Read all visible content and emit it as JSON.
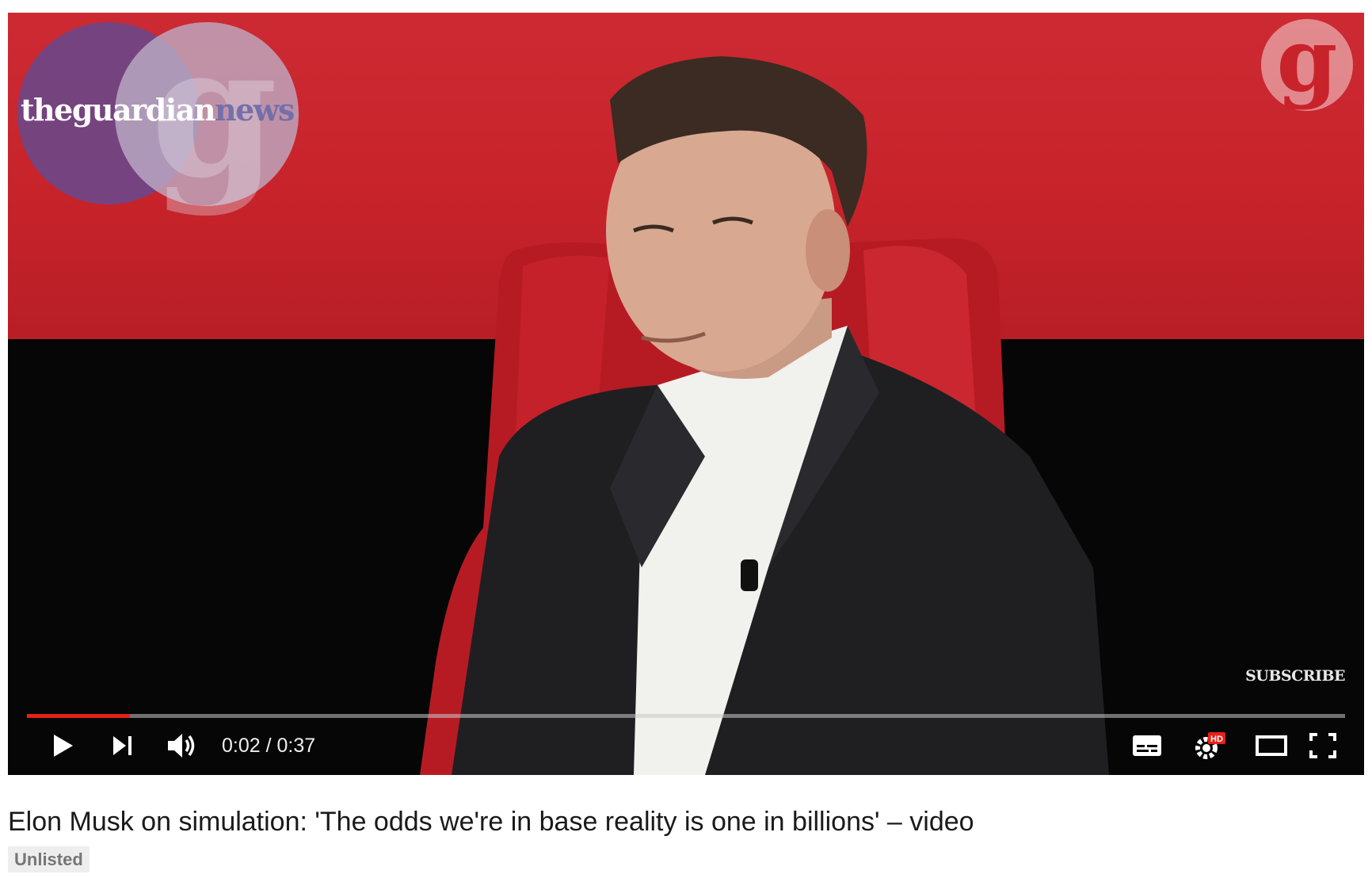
{
  "player": {
    "logo_part1": "theguardian",
    "logo_part2": "news",
    "watermark_letter": "g",
    "subscribe_label": "SUBSCRIBE",
    "time_current": "0:02",
    "time_separator": " / ",
    "time_total": "0:37",
    "progress_fraction": 0.078,
    "progress_color": "#e62117",
    "hd_badge": "HD",
    "icons": [
      "play-icon",
      "next-icon",
      "volume-icon",
      "captions-icon",
      "settings-icon",
      "theater-mode-icon",
      "fullscreen-icon"
    ]
  },
  "video": {
    "title": "Elon Musk on simulation: 'The odds we're in base reality is one in billions' – video",
    "visibility_badge": "Unlisted"
  }
}
